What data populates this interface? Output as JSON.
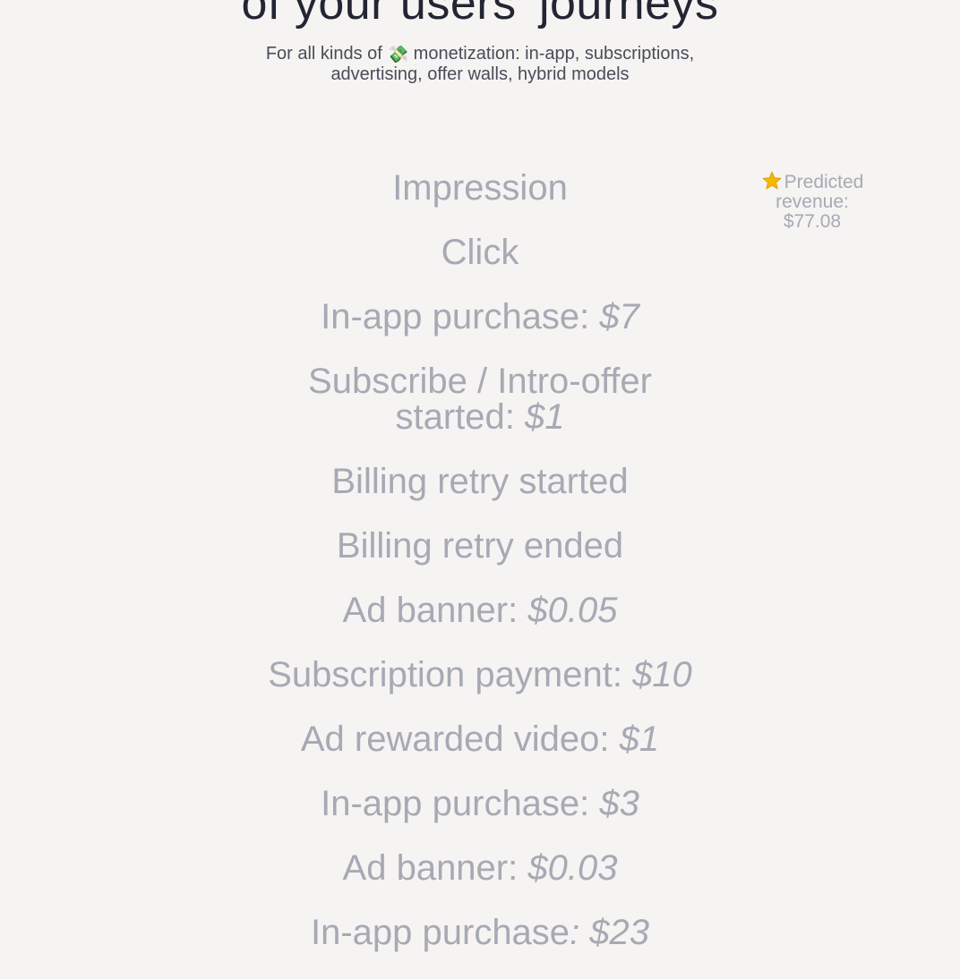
{
  "hero": {
    "title": "of your users' journeys",
    "subtitle_before_icon": "For all kinds of",
    "subtitle_icon": "money-with-wings-icon",
    "subtitle_after_icon": "monetization: in-app, subscriptions, advertising, offer walls, hybrid models"
  },
  "predicted": {
    "icon": "star-icon",
    "label": "Predicted revenue:",
    "value": "$77.08"
  },
  "events": [
    {
      "label": "Impression",
      "amount": ""
    },
    {
      "label": "Click",
      "amount": ""
    },
    {
      "label": "In-app purchase: ",
      "amount": "$7"
    },
    {
      "label": "Subscribe / Intro-offer started: ",
      "amount": "$1"
    },
    {
      "label": "Billing retry started",
      "amount": ""
    },
    {
      "label": "Billing retry ended",
      "amount": ""
    },
    {
      "label": "Ad banner: ",
      "amount": "$0.05"
    },
    {
      "label": "Subscription payment: ",
      "amount": "$10"
    },
    {
      "label": "Ad rewarded video: ",
      "amount": "$1"
    },
    {
      "label": "In-app purchase: ",
      "amount": "$3"
    },
    {
      "label": "Ad banner: ",
      "amount": "$0.03"
    },
    {
      "label": "In-app purchase",
      "amount": ": $23"
    }
  ],
  "colors": {
    "background": "#f5f4f2",
    "heading": "#232533",
    "subtitle": "#4a4c58",
    "muted_event": "#a7a9b4",
    "star": "#f5b800"
  }
}
